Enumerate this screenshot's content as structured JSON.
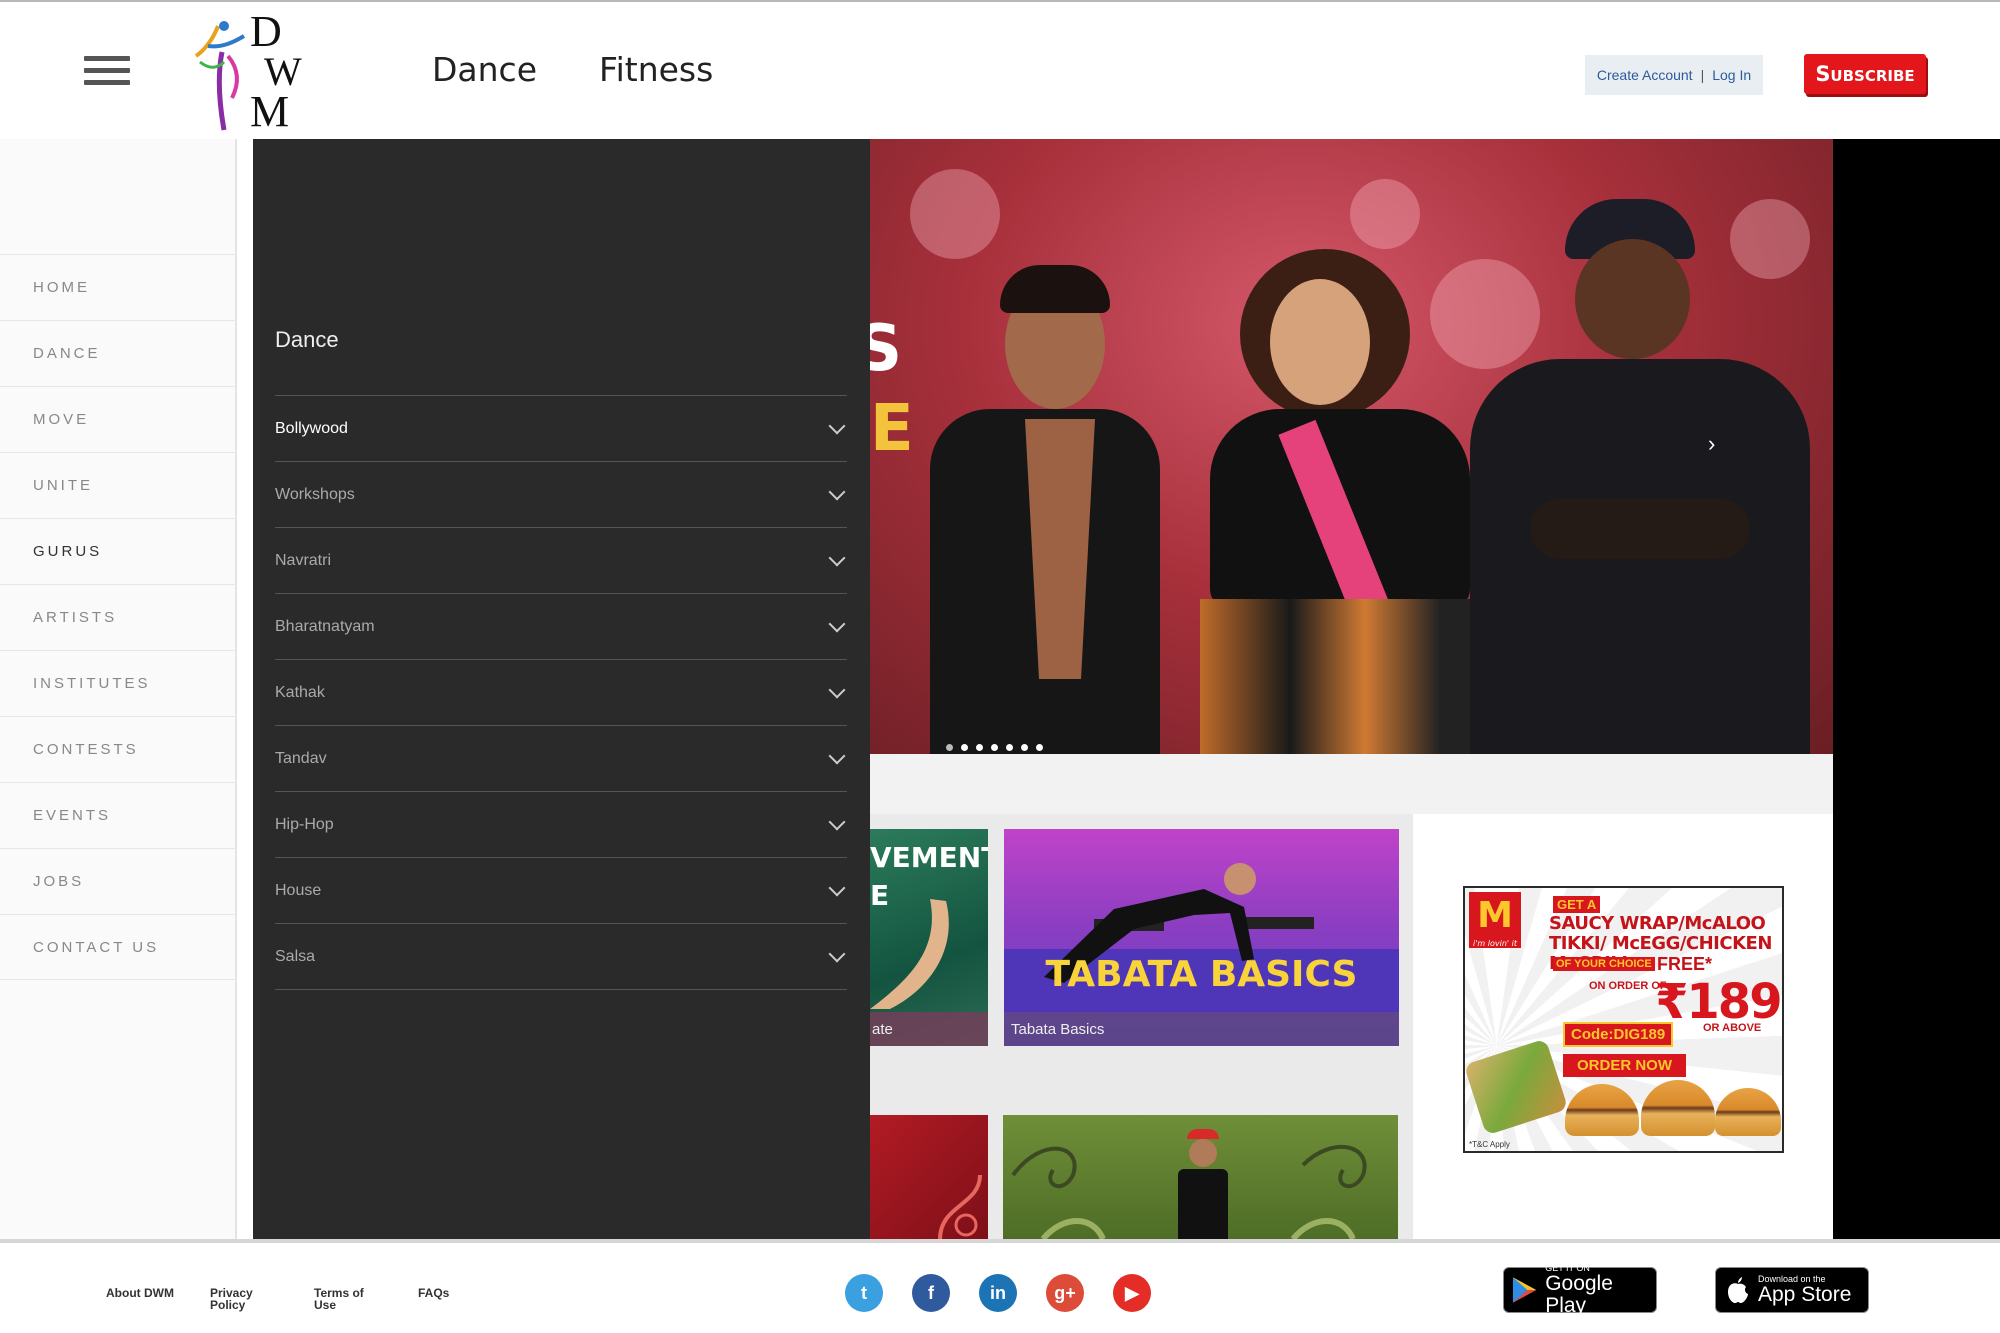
{
  "header": {
    "logo_text": [
      "D",
      "W",
      "M"
    ],
    "nav": [
      "Dance",
      "Fitness"
    ],
    "create_account": "Create Account",
    "separator": "|",
    "login": "Log In",
    "subscribe": "Subscribe"
  },
  "sidebar": {
    "items": [
      "HOME",
      "DANCE",
      "MOVE",
      "UNITE",
      "GURUS",
      "ARTISTS",
      "INSTITUTES",
      "CONTESTS",
      "EVENTS",
      "JOBS",
      "CONTACT US"
    ],
    "active": "GURUS"
  },
  "submenu": {
    "title": "Dance",
    "items": [
      "Bollywood",
      "Workshops",
      "Navratri",
      "Bharatnatyam",
      "Kathak",
      "Tandav",
      "Hip-Hop",
      "House",
      "Salsa"
    ],
    "active": "Bollywood"
  },
  "hero": {
    "partial_letters": [
      "S",
      "E"
    ],
    "next_arrow": "›",
    "slide_count": 7,
    "active_slide": 1
  },
  "cards": [
    {
      "title_partial": [
        "VEMENT",
        "E"
      ],
      "caption": "ate"
    },
    {
      "title": "TABATA BASICS",
      "caption": "Tabata Basics"
    }
  ],
  "ad": {
    "brand_tagline": "i'm lovin' it",
    "get_a": "GET A",
    "headline": "SAUCY WRAP/McALOO TIKKI/ McEGG/CHICKEN McGRILL",
    "your_choice": "OF YOUR CHOICE",
    "free": "FREE*",
    "on_order_of": "ON ORDER OF",
    "price": "₹189",
    "or_above": "OR ABOVE",
    "code": "Code:DIG189",
    "cta": "ORDER NOW",
    "tac": "*T&C Apply"
  },
  "footer": {
    "links": [
      "About DWM",
      "Privacy Policy",
      "Terms of Use",
      "FAQs"
    ],
    "social": [
      {
        "name": "twitter",
        "glyph": "t",
        "color": "#3aa0e0"
      },
      {
        "name": "facebook",
        "glyph": "f",
        "color": "#2f5a9e"
      },
      {
        "name": "linkedin",
        "glyph": "in",
        "color": "#1c74b5"
      },
      {
        "name": "google-plus",
        "glyph": "g+",
        "color": "#dd4b39"
      },
      {
        "name": "youtube",
        "glyph": "▶",
        "color": "#e52d27"
      }
    ],
    "google_play_small": "GET IT ON",
    "google_play_big": "Google Play",
    "app_store_small": "Download on the",
    "app_store_big": "App Store"
  }
}
